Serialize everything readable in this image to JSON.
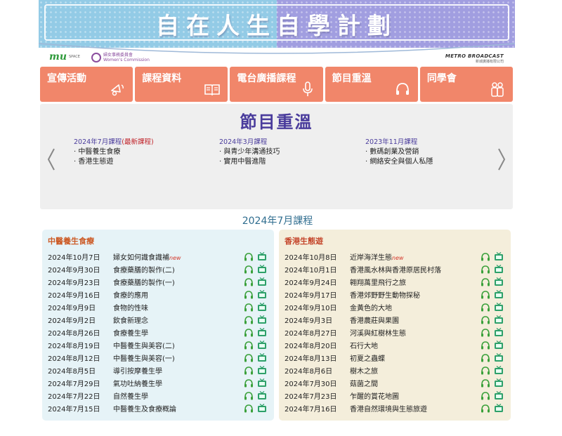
{
  "banner": {
    "title_part1": "自在人生",
    "title_part2": "自學計劃"
  },
  "logos": {
    "mu_mark": "mu",
    "mu_sub_1": "SPACE",
    "wc_name_1": "婦女事務委員會",
    "wc_name_2": "Women's Commission",
    "metro_name": "METRO BROADCAST",
    "metro_sub": "新城廣播有限公司"
  },
  "nav": {
    "items": [
      {
        "label": "宣傳活動",
        "icon": "megaphone-icon"
      },
      {
        "label": "課程資料",
        "icon": "book-icon"
      },
      {
        "label": "電台廣播課程",
        "icon": "microphone-icon"
      },
      {
        "label": "節目重溫",
        "icon": "headphones-icon"
      },
      {
        "label": "同學會",
        "icon": "people-icon"
      }
    ]
  },
  "slider": {
    "heading": "節目重溫",
    "columns": [
      {
        "title": "2024年7月課程",
        "new_tag": "(最新課程)",
        "items": [
          "· 中醫養生食療",
          "· 香港生態遊"
        ]
      },
      {
        "title": "2024年3月課程",
        "new_tag": "",
        "items": [
          "· 與青少年溝通技巧",
          "· 實用中醫進階"
        ]
      },
      {
        "title": "2023年11月課程",
        "new_tag": "",
        "items": [
          "· 數碼創業及營銷",
          "· 網絡安全與個人私隱"
        ]
      }
    ]
  },
  "section_title": "2024年7月課程",
  "panels": [
    {
      "title": "中醫養生食療",
      "rows": [
        {
          "date": "2024年10月7日",
          "topic": "婦女如何識食識補",
          "new": "new"
        },
        {
          "date": "2024年9月30日",
          "topic": "食療藥膳的製作(二)",
          "new": ""
        },
        {
          "date": "2024年9月23日",
          "topic": "食療藥膳的製作(一)",
          "new": ""
        },
        {
          "date": "2024年9月16日",
          "topic": "食療的應用",
          "new": ""
        },
        {
          "date": "2024年9月9日",
          "topic": "食物的性味",
          "new": ""
        },
        {
          "date": "2024年9月2日",
          "topic": "飲食新理念",
          "new": ""
        },
        {
          "date": "2024年8月26日",
          "topic": "食療養生學",
          "new": ""
        },
        {
          "date": "2024年8月19日",
          "topic": "中醫養生與美容(二)",
          "new": ""
        },
        {
          "date": "2024年8月12日",
          "topic": "中醫養生與美容(一)",
          "new": ""
        },
        {
          "date": "2024年8月5日",
          "topic": "導引按摩養生學",
          "new": ""
        },
        {
          "date": "2024年7月29日",
          "topic": "氣功吐納養生學",
          "new": ""
        },
        {
          "date": "2024年7月22日",
          "topic": "自然養生學",
          "new": ""
        },
        {
          "date": "2024年7月15日",
          "topic": "中醫養生及食療概論",
          "new": ""
        }
      ]
    },
    {
      "title": "香港生態遊",
      "rows": [
        {
          "date": "2024年10月8日",
          "topic": "近岸海洋生態",
          "new": "new"
        },
        {
          "date": "2024年10月1日",
          "topic": "香港風水林與香港原居民村落",
          "new": ""
        },
        {
          "date": "2024年9月24日",
          "topic": "翱翔萬里飛行之旅",
          "new": ""
        },
        {
          "date": "2024年9月17日",
          "topic": "香港郊野野生動物探秘",
          "new": ""
        },
        {
          "date": "2024年9月10日",
          "topic": "金黃色的大地",
          "new": ""
        },
        {
          "date": "2024年9月3日",
          "topic": "香港農莊與果園",
          "new": ""
        },
        {
          "date": "2024年8月27日",
          "topic": "河溪與紅樹林生態",
          "new": ""
        },
        {
          "date": "2024年8月20日",
          "topic": "石行大地",
          "new": ""
        },
        {
          "date": "2024年8月13日",
          "topic": "初夏之蟲蝶",
          "new": ""
        },
        {
          "date": "2024年8月6日",
          "topic": "樹木之旅",
          "new": ""
        },
        {
          "date": "2024年7月30日",
          "topic": "菇菌之間",
          "new": ""
        },
        {
          "date": "2024年7月23日",
          "topic": "乍醒的賞花地圖",
          "new": ""
        },
        {
          "date": "2024年7月16日",
          "topic": "香港自然環境與生態旅遊",
          "new": ""
        }
      ]
    }
  ],
  "colors": {
    "banner_left": "#93cbe6",
    "banner_right": "#a19ee0",
    "nav_bg": "#f1866a",
    "heading": "#4a3c9c",
    "panel_a_bg": "#e6f3f7",
    "panel_b_bg": "#f4eedb",
    "audio_icon": "#3aa03a",
    "video_icon": "#2ea06a"
  },
  "row_icons": [
    "headphones-icon",
    "tv-icon"
  ]
}
